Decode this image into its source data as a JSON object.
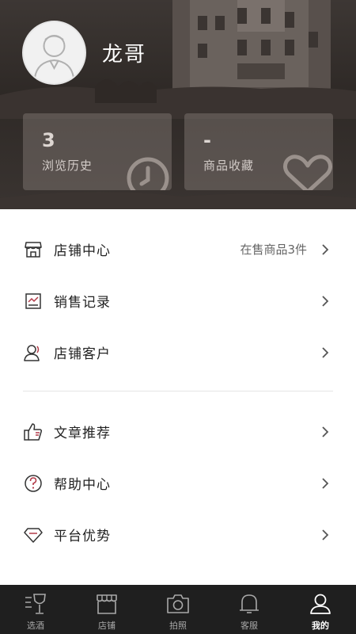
{
  "profile": {
    "username": "龙哥"
  },
  "stats": {
    "history": {
      "value": "3",
      "label": "浏览历史",
      "icon": "clock-icon"
    },
    "favorites": {
      "value": "-",
      "label": "商品收藏",
      "icon": "heart-icon"
    }
  },
  "menu": {
    "store_center": {
      "label": "店铺中心",
      "extra": "在售商品3件",
      "icon": "store-icon"
    },
    "sales_records": {
      "label": "销售记录",
      "icon": "sales-chart-icon"
    },
    "store_customers": {
      "label": "店铺客户",
      "icon": "customers-icon"
    },
    "article_recommend": {
      "label": "文章推荐",
      "icon": "thumbs-up-icon"
    },
    "help_center": {
      "label": "帮助中心",
      "icon": "question-icon"
    },
    "platform_advantage": {
      "label": "平台优势",
      "icon": "diamond-icon"
    }
  },
  "nav": {
    "items": [
      {
        "label": "选酒",
        "icon": "wine-glass-icon"
      },
      {
        "label": "店铺",
        "icon": "shop-icon"
      },
      {
        "label": "拍照",
        "icon": "camera-icon"
      },
      {
        "label": "客服",
        "icon": "bell-icon"
      },
      {
        "label": "我的",
        "icon": "user-icon",
        "active": true
      }
    ]
  },
  "colors": {
    "header_bg": "#2e2926",
    "nav_bg": "#1f1f1f",
    "text": "#222222",
    "muted": "#666666"
  }
}
